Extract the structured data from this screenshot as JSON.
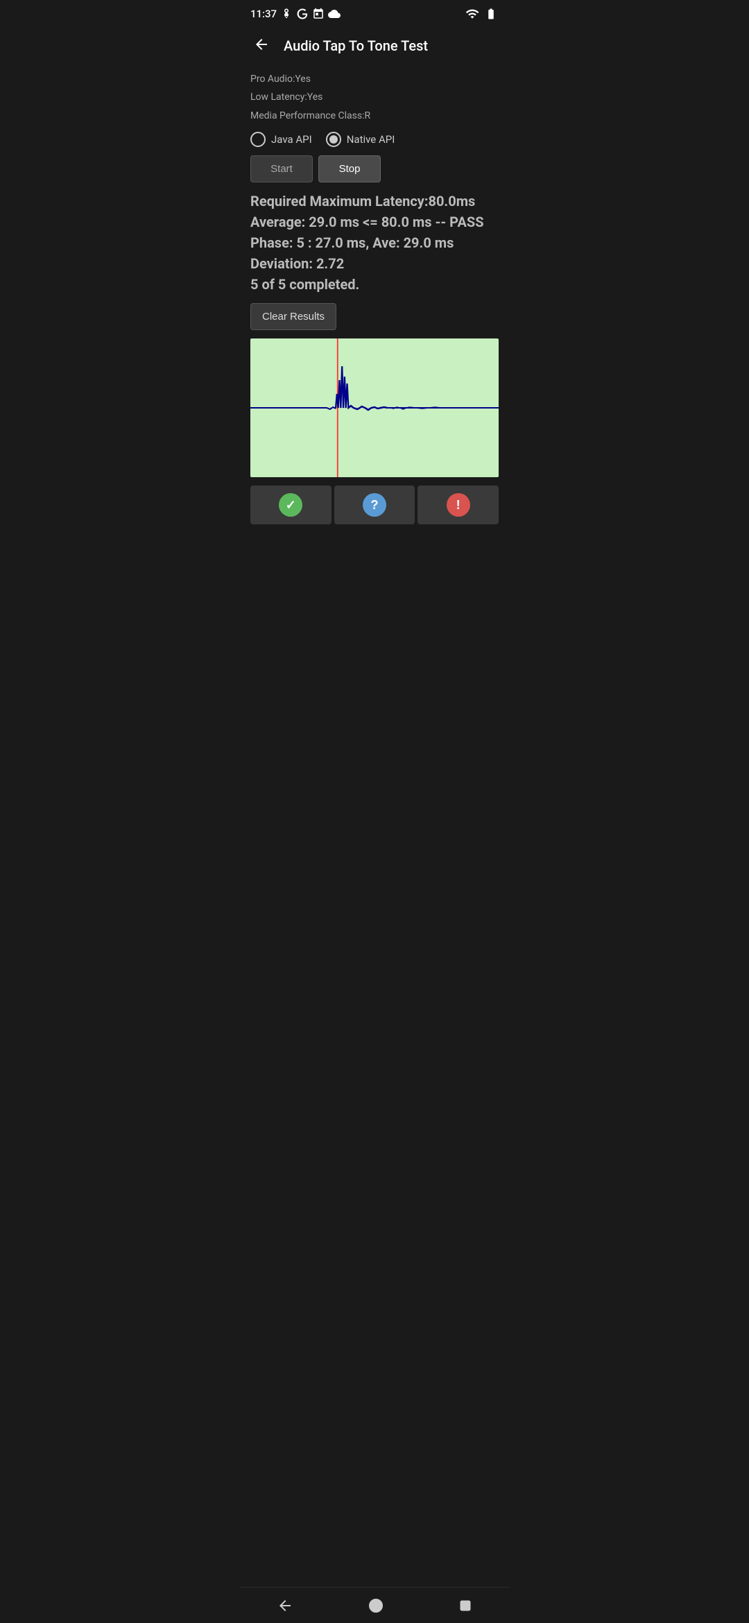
{
  "statusBar": {
    "time": "11:37",
    "leftIcons": [
      "fan-icon",
      "google-icon",
      "calendar-icon",
      "cloud-icon"
    ],
    "rightIcons": [
      "wifi-icon",
      "battery-icon"
    ]
  },
  "toolbar": {
    "backLabel": "←",
    "title": "Audio Tap To Tone Test"
  },
  "info": {
    "proAudio": "Pro Audio:Yes",
    "lowLatency": "Low Latency:Yes",
    "mediaPerformance": "Media Performance Class:R"
  },
  "apiSelector": {
    "javaLabel": "Java API",
    "nativeLabel": "Native API",
    "selected": "native"
  },
  "buttons": {
    "startLabel": "Start",
    "stopLabel": "Stop"
  },
  "results": {
    "line1": "Required Maximum Latency:80.0ms",
    "line2": "Average: 29.0 ms <= 80.0 ms -- PASS",
    "line3": "Phase: 5 : 27.0 ms, Ave: 29.0 ms",
    "line4": "Deviation: 2.72",
    "line5": "5 of 5 completed.",
    "clearLabel": "Clear Results"
  },
  "waveform": {
    "bgColor": "#c8f0c0",
    "lineColor": "#00008b",
    "redLineX": 0.35
  },
  "actionButtons": [
    {
      "id": "pass",
      "iconType": "check",
      "color": "green",
      "label": "Pass"
    },
    {
      "id": "unknown",
      "iconType": "question",
      "color": "blue",
      "label": "Unknown"
    },
    {
      "id": "fail",
      "iconType": "exclamation",
      "color": "red",
      "label": "Fail"
    }
  ],
  "navBar": {
    "backLabel": "Back",
    "homeLabel": "Home",
    "recentLabel": "Recent"
  }
}
